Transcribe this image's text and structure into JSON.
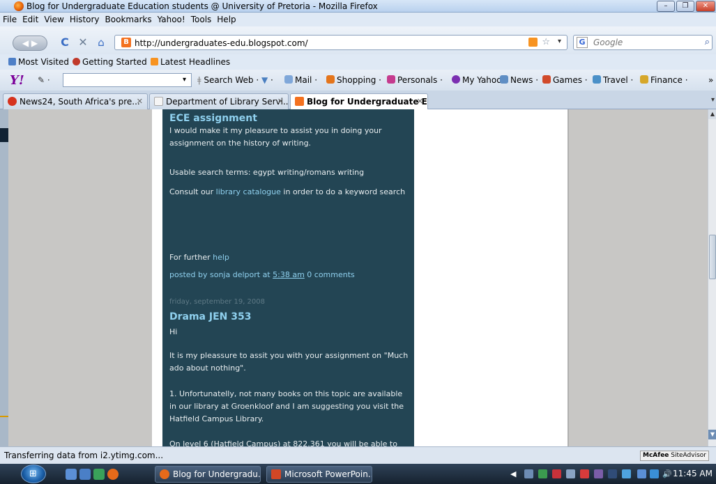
{
  "window": {
    "title": "Blog for Undergraduate Education students @ University of Pretoria - Mozilla Firefox",
    "minimize": "–",
    "maximize": "❐",
    "close": "✕"
  },
  "menu": [
    "File",
    "Edit",
    "View",
    "History",
    "Bookmarks",
    "Yahoo!",
    "Tools",
    "Help"
  ],
  "nav": {
    "url": "http://undergraduates-edu.blogspot.com/",
    "search_placeholder": "Google",
    "search_engine": "G"
  },
  "bookmarks": [
    {
      "label": "Most Visited",
      "icon": "most-visited-icon",
      "color": "#4d7fc7"
    },
    {
      "label": "Getting Started",
      "icon": "getting-started-icon",
      "color": "#c0392b"
    },
    {
      "label": "Latest Headlines",
      "icon": "rss-icon",
      "color": "#f79321"
    }
  ],
  "yahoo_toolbar": {
    "logo": "Y!",
    "search_label": "Search Web",
    "items": [
      {
        "label": "Mail",
        "icon": "mail-icon",
        "color": "#7fa7d9"
      },
      {
        "label": "Shopping",
        "icon": "shopping-icon",
        "color": "#e4751b"
      },
      {
        "label": "Personals",
        "icon": "personals-icon",
        "color": "#c53b8e"
      },
      {
        "label": "My Yahoo!",
        "icon": "my-yahoo-icon",
        "color": "#7b2fb1"
      },
      {
        "label": "News",
        "icon": "news-icon",
        "color": "#5f8ec4"
      },
      {
        "label": "Games",
        "icon": "games-icon",
        "color": "#d14a2a"
      },
      {
        "label": "Travel",
        "icon": "travel-icon",
        "color": "#4a90c8"
      },
      {
        "label": "Finance",
        "icon": "finance-icon",
        "color": "#d6a72a"
      }
    ]
  },
  "tabs": [
    {
      "label": "News24, South Africa's pre...",
      "icon": "news24-icon",
      "color": "#d6331f"
    },
    {
      "label": "Department of Library Servi...",
      "icon": "page-icon",
      "color": "#e8e8e8"
    },
    {
      "label": "Blog for Undergraduate E...",
      "icon": "blogger-icon",
      "color": "#f4711f"
    }
  ],
  "posts": {
    "p1": {
      "title": "ECE assignment",
      "para1": "I would make it my pleasure to assist you in doing your assignment on the history of writing.",
      "para2": "Usable search terms: egypt writing/romans writing",
      "para3_before": "Consult our ",
      "para3_link": "library catalogue",
      "para3_after": " in order to do a keyword search",
      "para4_before": "For further ",
      "para4_link": "help",
      "meta_before": "posted by sonja delport at ",
      "meta_time": "5:38 am",
      "meta_comments": "0 comments"
    },
    "p2": {
      "date": "friday, september 19, 2008",
      "title": "Drama JEN 353",
      "para1": "Hi",
      "para2": "It is my pleassure to assit you with your assignment on \"Much ado about nothing\".",
      "para3": "1. Unfortunatelly, not many books on this topic are available in our library at Groenkloof and I am suggesting you visit the Hatfield Campus Library.",
      "para4": "On level 6 (Hatfield Campus) at 822.361 you will be able to"
    }
  },
  "status": {
    "text": "Transferring data from i2.ytimg.com...",
    "mcafee_brand": "McAfee",
    "mcafee_product": "SiteAdvisor"
  },
  "taskbar": {
    "buttons": [
      {
        "label": "Blog for Undergradu...",
        "icon": "firefox-icon",
        "color": "#e66a1a"
      },
      {
        "label": "Microsoft PowerPoin...",
        "icon": "powerpoint-icon",
        "color": "#d24726"
      }
    ],
    "clock": "11:45 AM"
  }
}
